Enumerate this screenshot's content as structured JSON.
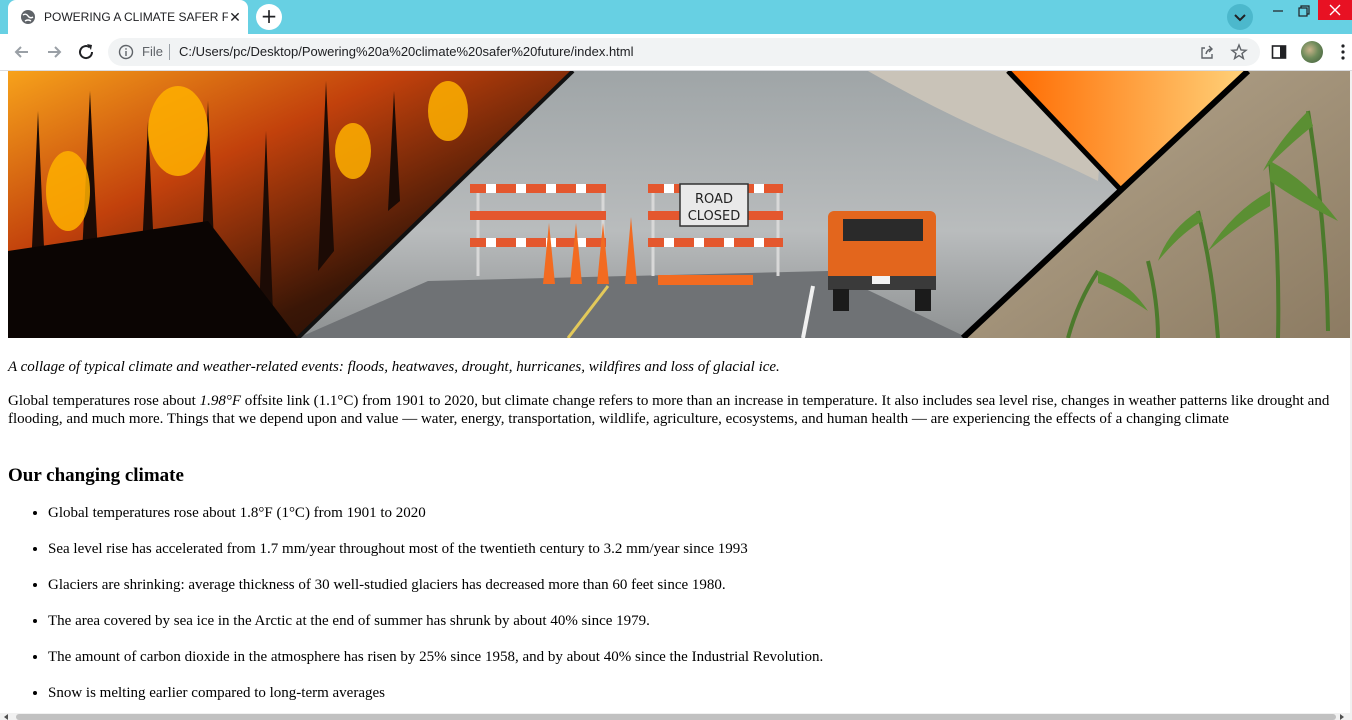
{
  "browser": {
    "tab_title": "POWERING A CLIMATE SAFER FUTURE",
    "new_tab_symbol": "+",
    "close_tab_symbol": "✕",
    "url_scheme_label": "File",
    "url": "C:/Users/pc/Desktop/Powering%20a%20climate%20safer%20future/index.html",
    "accent_color": "#67d0e3"
  },
  "hero_image": {
    "description_icons": [
      "wildfire",
      "flooded-road-closed",
      "drought-cornfield"
    ],
    "road_sign_text": [
      "ROAD",
      "CLOSED"
    ]
  },
  "content": {
    "caption": "A collage of typical climate and weather-related events: floods, heatwaves, drought, hurricanes, wildfires and loss of glacial ice.",
    "intro_pre": "Global temperatures rose about ",
    "intro_em": "1.98°F",
    "intro_post": " offsite link (1.1°C) from 1901 to 2020, but climate change refers to more than an increase in temperature. It also includes sea level rise, changes in weather patterns like drought and flooding, and much more. Things that we depend upon and value — water, energy, transportation, wildlife, agriculture, ecosystems, and human health — are experiencing the effects of a changing climate",
    "section_heading": "Our changing climate",
    "facts": [
      "Global temperatures rose about 1.8°F (1°C) from 1901 to 2020",
      "Sea level rise has accelerated from 1.7 mm/year throughout most of the twentieth century to 3.2 mm/year since 1993",
      "Glaciers are shrinking: average thickness of 30 well-studied glaciers has decreased more than 60 feet since 1980.",
      "The area covered by sea ice in the Arctic at the end of summer has shrunk by about 40% since 1979.",
      "The amount of carbon dioxide in the atmosphere has risen by 25% since 1958, and by about 40% since the Industrial Revolution.",
      "Snow is melting earlier compared to long-term averages"
    ]
  }
}
